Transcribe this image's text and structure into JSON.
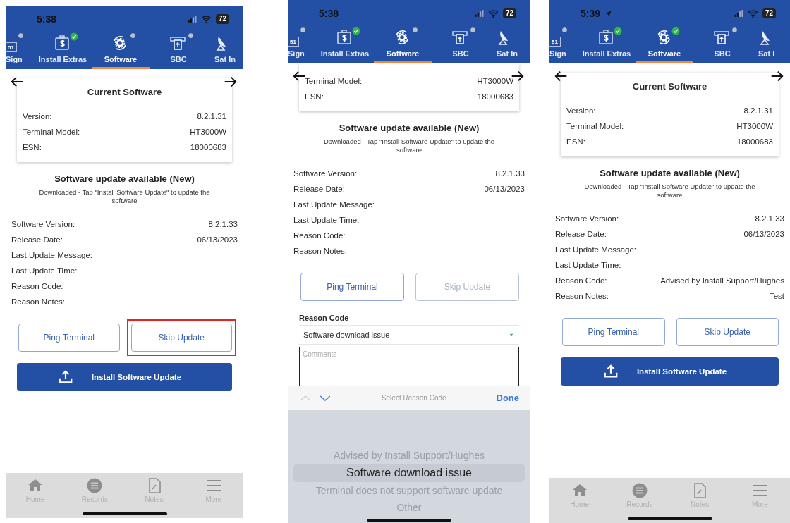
{
  "screens": [
    {
      "status": {
        "time": "5:38",
        "location": false,
        "battery": "72"
      },
      "tabs": [
        {
          "label": "Sign",
          "kind": "id",
          "icon_text": "51",
          "checked": false,
          "selected": false
        },
        {
          "label": "Install Extras",
          "kind": "money",
          "checked": true,
          "selected": false
        },
        {
          "label": "Software",
          "kind": "gear",
          "checked": false,
          "selected": true
        },
        {
          "label": "SBC",
          "kind": "sbc",
          "checked": false,
          "selected": false
        },
        {
          "label": "Sat In",
          "kind": "dish",
          "selected": false
        }
      ],
      "current": {
        "title": "Current Software",
        "rows": [
          {
            "label": "Version:",
            "value": "8.2.1.31"
          },
          {
            "label": "Terminal Model:",
            "value": "HT3000W"
          },
          {
            "label": "ESN:",
            "value": "18000683"
          }
        ]
      },
      "update": {
        "title": "Software update available (New)",
        "note": "Downloaded - Tap \"Install Software Update\" to update the software",
        "rows": [
          {
            "label": "Software Version:",
            "value": "8.2.1.33"
          },
          {
            "label": "Release Date:",
            "value": "06/13/2023"
          },
          {
            "label": "Last Update Message:"
          },
          {
            "label": "Last Update Time:"
          },
          {
            "label": "Reason Code:"
          },
          {
            "label": "Reason Notes:"
          }
        ]
      },
      "actions": [
        {
          "label": "Ping Terminal",
          "disabled": false,
          "highlighted": false
        },
        {
          "label": "Skip Update",
          "disabled": false,
          "highlighted": true
        }
      ],
      "install_button": "Install Software Update",
      "bottom_nav": [
        {
          "label": "Home",
          "kind": "home"
        },
        {
          "label": "Records",
          "kind": "records"
        },
        {
          "label": "Notes",
          "kind": "notes"
        },
        {
          "label": "More",
          "kind": "more"
        }
      ]
    },
    {
      "status": {
        "time": "5:38",
        "location": false,
        "battery": "72"
      },
      "tabs": [
        {
          "label": "Sign",
          "kind": "id",
          "icon_text": "51",
          "checked": false,
          "selected": false
        },
        {
          "label": "Install Extras",
          "kind": "money",
          "checked": true,
          "selected": false
        },
        {
          "label": "Software",
          "kind": "gear",
          "checked": false,
          "selected": true
        },
        {
          "label": "SBC",
          "kind": "sbc",
          "checked": false,
          "selected": false
        },
        {
          "label": "Sat In",
          "kind": "dish",
          "selected": false
        }
      ],
      "current": {
        "rows": [
          {
            "label": "Terminal Model:",
            "value": "HT3000W"
          },
          {
            "label": "ESN:",
            "value": "18000683"
          }
        ]
      },
      "update": {
        "title": "Software update available (New)",
        "note": "Downloaded - Tap \"Install Software Update\" to update the software",
        "rows": [
          {
            "label": "Software Version:",
            "value": "8.2.1.33"
          },
          {
            "label": "Release Date:",
            "value": "06/13/2023"
          },
          {
            "label": "Last Update Message:"
          },
          {
            "label": "Last Update Time:"
          },
          {
            "label": "Reason Code:"
          },
          {
            "label": "Reason Notes:"
          }
        ]
      },
      "actions": [
        {
          "label": "Ping Terminal",
          "disabled": false,
          "highlighted": false
        },
        {
          "label": "Skip Update",
          "disabled": true,
          "highlighted": false
        }
      ],
      "reason_form": {
        "label": "Reason Code",
        "value": "Software download issue",
        "comments_placeholder": "Comments"
      },
      "picker": {
        "title": "Select Reason Code",
        "done": "Done",
        "arrows": [
          {
            "kind": "up",
            "disabled": true
          },
          {
            "kind": "down",
            "disabled": false
          }
        ],
        "options": [
          {
            "label": "Advised by Install Support/Hughes",
            "selected": false
          },
          {
            "label": "Software download issue",
            "selected": true
          },
          {
            "label": "Terminal does not support software update",
            "selected": false
          },
          {
            "label": "Other",
            "selected": false
          }
        ]
      }
    },
    {
      "status": {
        "time": "5:39",
        "location": true,
        "battery": "72"
      },
      "tabs": [
        {
          "label": "Sign",
          "kind": "id",
          "icon_text": "51",
          "checked": false,
          "selected": false
        },
        {
          "label": "Install Extras",
          "kind": "money",
          "checked": true,
          "selected": false
        },
        {
          "label": "Software",
          "kind": "gear",
          "checked": true,
          "selected": true
        },
        {
          "label": "SBC",
          "kind": "sbc",
          "checked": false,
          "selected": false
        },
        {
          "label": "Sat I",
          "kind": "dish",
          "selected": false
        }
      ],
      "current": {
        "title": "Current Software",
        "rows": [
          {
            "label": "Version:",
            "value": "8.2.1.31"
          },
          {
            "label": "Terminal Model:",
            "value": "HT3000W"
          },
          {
            "label": "ESN:",
            "value": "18000683"
          }
        ]
      },
      "update": {
        "title": "Software update available (New)",
        "note": "Downloaded - Tap \"Install Software Update\" to update the software",
        "rows": [
          {
            "label": "Software Version:",
            "value": "8.2.1.33"
          },
          {
            "label": "Release Date:",
            "value": "06/13/2023"
          },
          {
            "label": "Last Update Message:"
          },
          {
            "label": "Last Update Time:"
          },
          {
            "label": "Reason Code:",
            "value": "Advised by Install Support/Hughes"
          },
          {
            "label": "Reason Notes:",
            "value": "Test"
          }
        ]
      },
      "actions": [
        {
          "label": "Ping Terminal",
          "disabled": false,
          "highlighted": false
        },
        {
          "label": "Skip Update",
          "disabled": false,
          "highlighted": false
        }
      ],
      "install_button": "Install Software Update",
      "bottom_nav": [
        {
          "label": "Home",
          "kind": "home"
        },
        {
          "label": "Records",
          "kind": "records"
        },
        {
          "label": "Notes",
          "kind": "notes"
        },
        {
          "label": "More",
          "kind": "more"
        }
      ]
    }
  ]
}
